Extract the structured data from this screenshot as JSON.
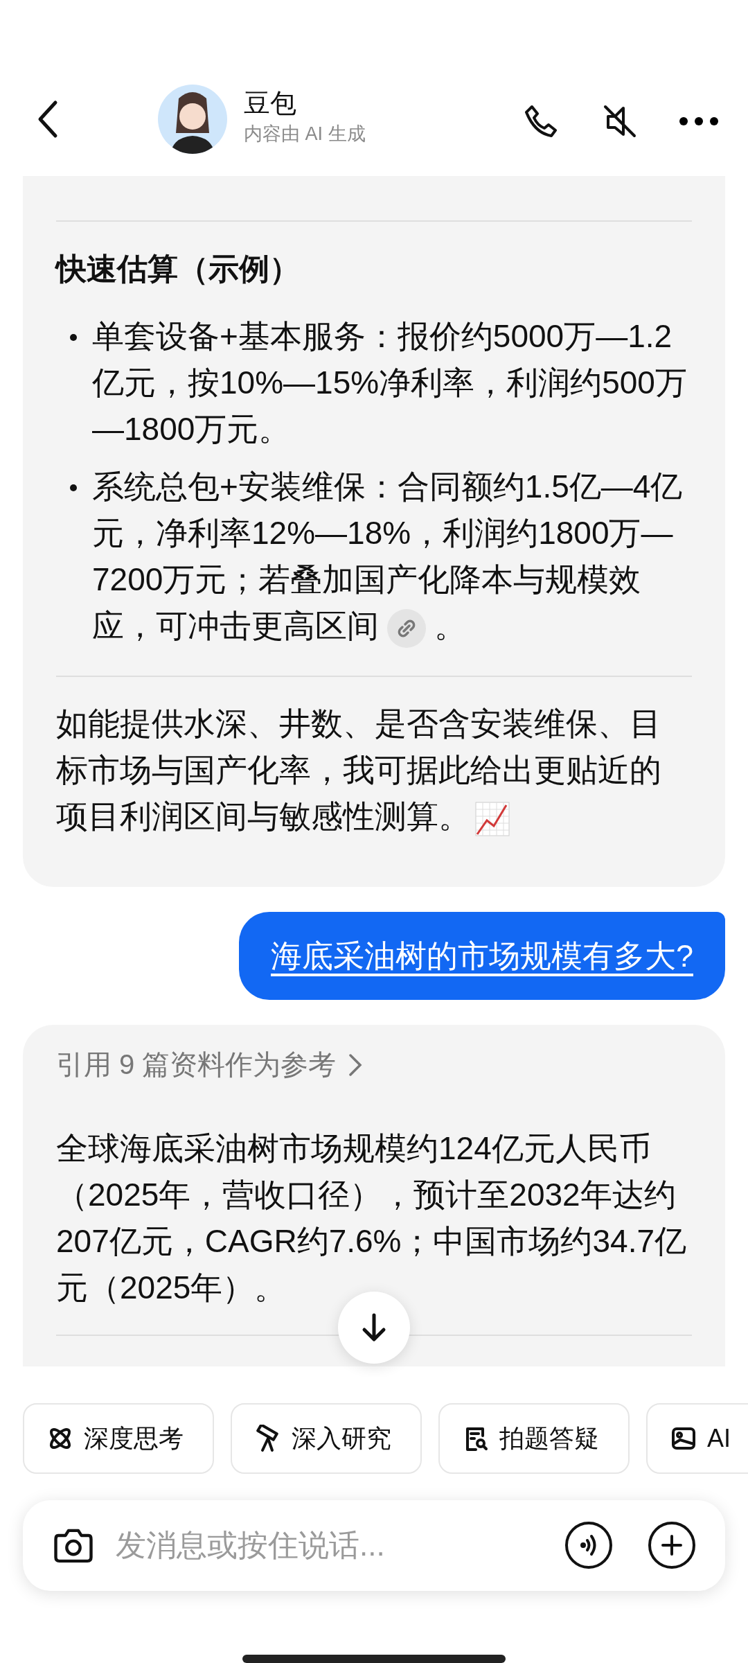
{
  "header": {
    "title": "豆包",
    "subtitle": "内容由 AI 生成"
  },
  "messages": [
    {
      "kind": "bot",
      "blocks": [
        {
          "kind": "divider"
        },
        {
          "kind": "heading",
          "text": "快速估算（示例）"
        },
        {
          "kind": "bullets",
          "items": [
            {
              "text": "单套设备+基本服务：报价约5000万—1.2亿元，按10%—15%净利率，利润约500万—1800万元。",
              "source_link": false
            },
            {
              "text": "系统总包+安装维保：合同额约1.5亿—4亿元，净利率12%—18%，利润约1800万—7200万元；若叠加国产化降本与规模效应，可冲击更高区间",
              "source_link": true,
              "tail": "。"
            }
          ]
        },
        {
          "kind": "divider"
        },
        {
          "kind": "paragraph",
          "text": "如能提供水深、井数、是否含安装维保、目标市场与国产化率，我可据此给出更贴近的项目利润区间与敏感性测算。",
          "trend_icon": true
        }
      ]
    },
    {
      "kind": "user",
      "text": "海底采油树的市场规模有多大?"
    },
    {
      "kind": "bot",
      "references": "引用 9 篇资料作为参考",
      "blocks": [
        {
          "kind": "paragraph",
          "text": "全球海底采油树市场规模约124亿元人民币（2025年，营收口径），预计至2032年达约207亿元，CAGR约7.6%；中国市场约34.7亿元（2025年）。",
          "trend_icon": false
        },
        {
          "kind": "divider"
        }
      ]
    }
  ],
  "chips": [
    {
      "kind": "atom",
      "label": "深度思考"
    },
    {
      "kind": "telescope",
      "label": "深入研究"
    },
    {
      "kind": "doc-search",
      "label": "拍题答疑"
    },
    {
      "kind": "image",
      "label": "AI"
    }
  ],
  "input": {
    "placeholder": "发消息或按住说话..."
  }
}
